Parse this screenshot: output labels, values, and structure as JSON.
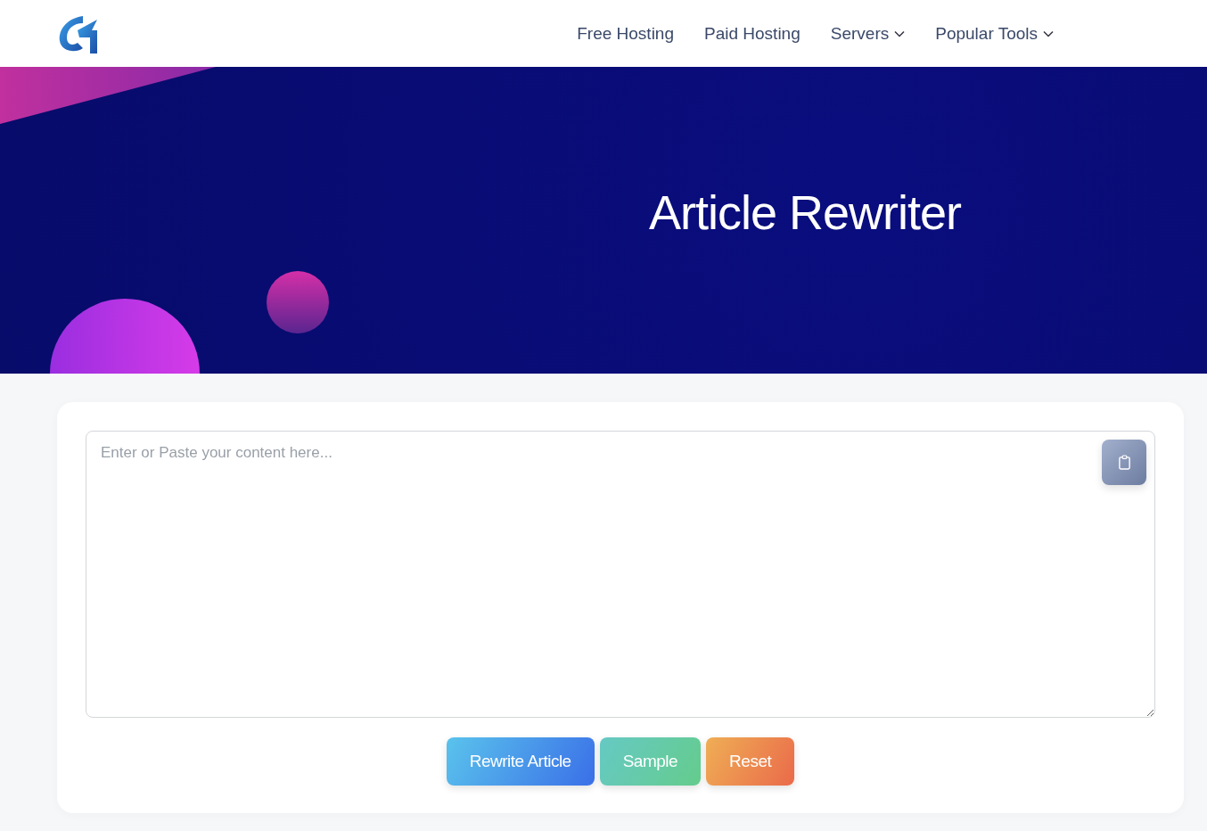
{
  "nav": [
    {
      "label": "Free Hosting",
      "has_menu": false
    },
    {
      "label": "Paid Hosting",
      "has_menu": false
    },
    {
      "label": "Servers",
      "has_menu": true
    },
    {
      "label": "Popular Tools",
      "has_menu": true
    }
  ],
  "hero": {
    "title": "Article Rewriter"
  },
  "editor": {
    "placeholder": "Enter or Paste your content here..."
  },
  "buttons": [
    {
      "label": "Rewrite Article",
      "kind": "primary"
    },
    {
      "label": "Sample",
      "kind": "sample"
    },
    {
      "label": "Reset",
      "kind": "reset"
    }
  ]
}
